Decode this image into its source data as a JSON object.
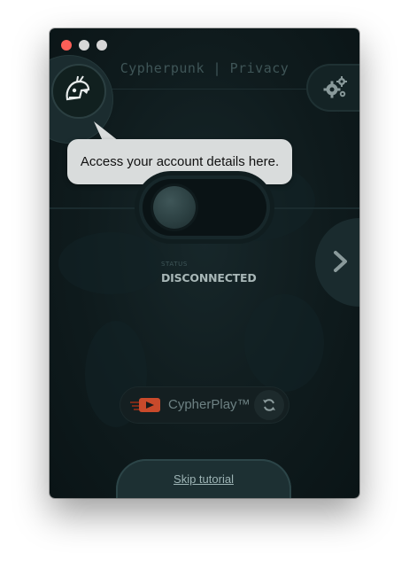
{
  "window": {
    "title": "Cypherpunk | Privacy"
  },
  "header": {
    "account_icon": "helmet-icon",
    "settings_icon": "gears-icon"
  },
  "tooltip": {
    "text": "Access your account details here."
  },
  "connection": {
    "status_label": "STATUS",
    "status_value": "DISCONNECTED",
    "next_icon": "chevron-right-icon"
  },
  "cypherplay": {
    "label": "CypherPlay™",
    "icon": "play-icon",
    "refresh_icon": "refresh-icon"
  },
  "tutorial": {
    "skip_label": "Skip tutorial"
  },
  "colors": {
    "background": "#0f1b1d",
    "tooltip_bg": "#d9dcdc",
    "close_dot": "#fd5f57",
    "accent_play": "#c94a2b"
  }
}
